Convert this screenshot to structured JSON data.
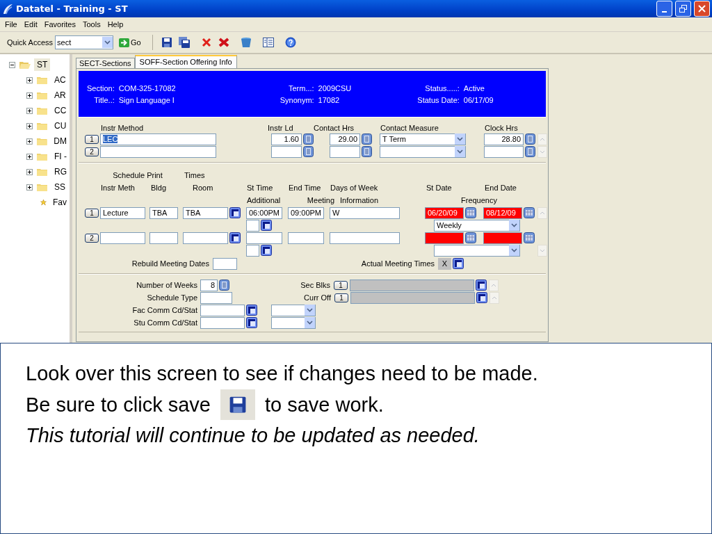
{
  "window": {
    "title": "Datatel - Training - ST"
  },
  "menu": [
    "File",
    "Edit",
    "Favorites",
    "Tools",
    "Help"
  ],
  "toolbar": {
    "quick_access_label": "Quick Access",
    "quick_access_value": "sect",
    "go_label": "Go"
  },
  "tree": {
    "label": "ST",
    "expanded": true,
    "selected": true,
    "children": [
      {
        "label": "AC",
        "kind": "folder",
        "expanded": false,
        "selected": false
      },
      {
        "label": "AR",
        "kind": "folder",
        "expanded": false,
        "selected": false
      },
      {
        "label": "CC",
        "kind": "folder",
        "expanded": false,
        "selected": false
      },
      {
        "label": "CU",
        "kind": "folder",
        "expanded": false,
        "selected": false
      },
      {
        "label": "DM",
        "kind": "folder",
        "expanded": false,
        "selected": false
      },
      {
        "label": "FI -",
        "kind": "folder",
        "expanded": false,
        "selected": false
      },
      {
        "label": "RG",
        "kind": "folder",
        "expanded": false,
        "selected": false
      },
      {
        "label": "SS",
        "kind": "folder",
        "expanded": false,
        "selected": false
      },
      {
        "label": "Fav",
        "kind": "favorite",
        "selected": false
      }
    ]
  },
  "tabs": [
    {
      "label": "SECT-Sections",
      "selected": false
    },
    {
      "label": "SOFF-Section Offering Info",
      "selected": true
    }
  ],
  "header": [
    [
      {
        "label": "Section:",
        "value": "COM-325-17082"
      },
      {
        "label": "Title..:",
        "value": "Sign Language I"
      }
    ],
    [
      {
        "label": "Term...:",
        "value": "2009CSU"
      },
      {
        "label": "Synonym:",
        "value": "17082"
      }
    ],
    [
      {
        "label": "Status.....:",
        "value": "Active"
      },
      {
        "label": "Status Date:",
        "value": "06/17/09"
      }
    ]
  ],
  "instr": {
    "columns": [
      "Instr Method",
      "Instr Ld",
      "Contact Hrs",
      "Contact Measure",
      "Clock Hrs"
    ],
    "rows": [
      {
        "num": "1",
        "method": "LEC",
        "method_highlighted": true,
        "load": "1.60",
        "contact_hrs": "29.00",
        "measure": "T Term",
        "clock": "28.80"
      },
      {
        "num": "2"
      }
    ]
  },
  "schedule": {
    "group_labels": [
      "Schedule Print",
      "Times"
    ],
    "columns": [
      "Instr Meth",
      "Bldg",
      "Room",
      "St Time",
      "End Time",
      "Days of Week",
      "St Date",
      "End Date"
    ],
    "sub_columns": [
      "Additional",
      "Meeting",
      "Information",
      "Frequency"
    ],
    "rows": [
      {
        "num": "1",
        "instr_meth": "Lecture",
        "bldg": "TBA",
        "room": "TBA",
        "st_time": "06:00PM",
        "end_time": "09:00PM",
        "days": "W",
        "st_date": "06/20/09",
        "end_date": "08/12/09",
        "frequency": "Weekly",
        "required": true
      },
      {
        "num": "2",
        "required": true
      }
    ],
    "rebuild_label": "Rebuild Meeting Dates",
    "actual_label": "Actual Meeting Times",
    "actual_value": "X"
  },
  "bottom": {
    "weeks_label": "Number of Weeks",
    "weeks_value": "8",
    "schedule_type_label": "Schedule Type",
    "fac_label": "Fac Comm Cd/Stat",
    "stu_label": "Stu Comm Cd/Stat",
    "sec_blks_label": "Sec Blks",
    "sec_blks_num": "1",
    "curr_off_label": "Curr Off",
    "curr_off_num": "1"
  },
  "note": {
    "line1": "Look over this screen to see if changes need to be made.",
    "line2_before": "Be sure to click save",
    "line2_after": "to save work.",
    "line3": "This tutorial will continue to be updated as needed."
  }
}
